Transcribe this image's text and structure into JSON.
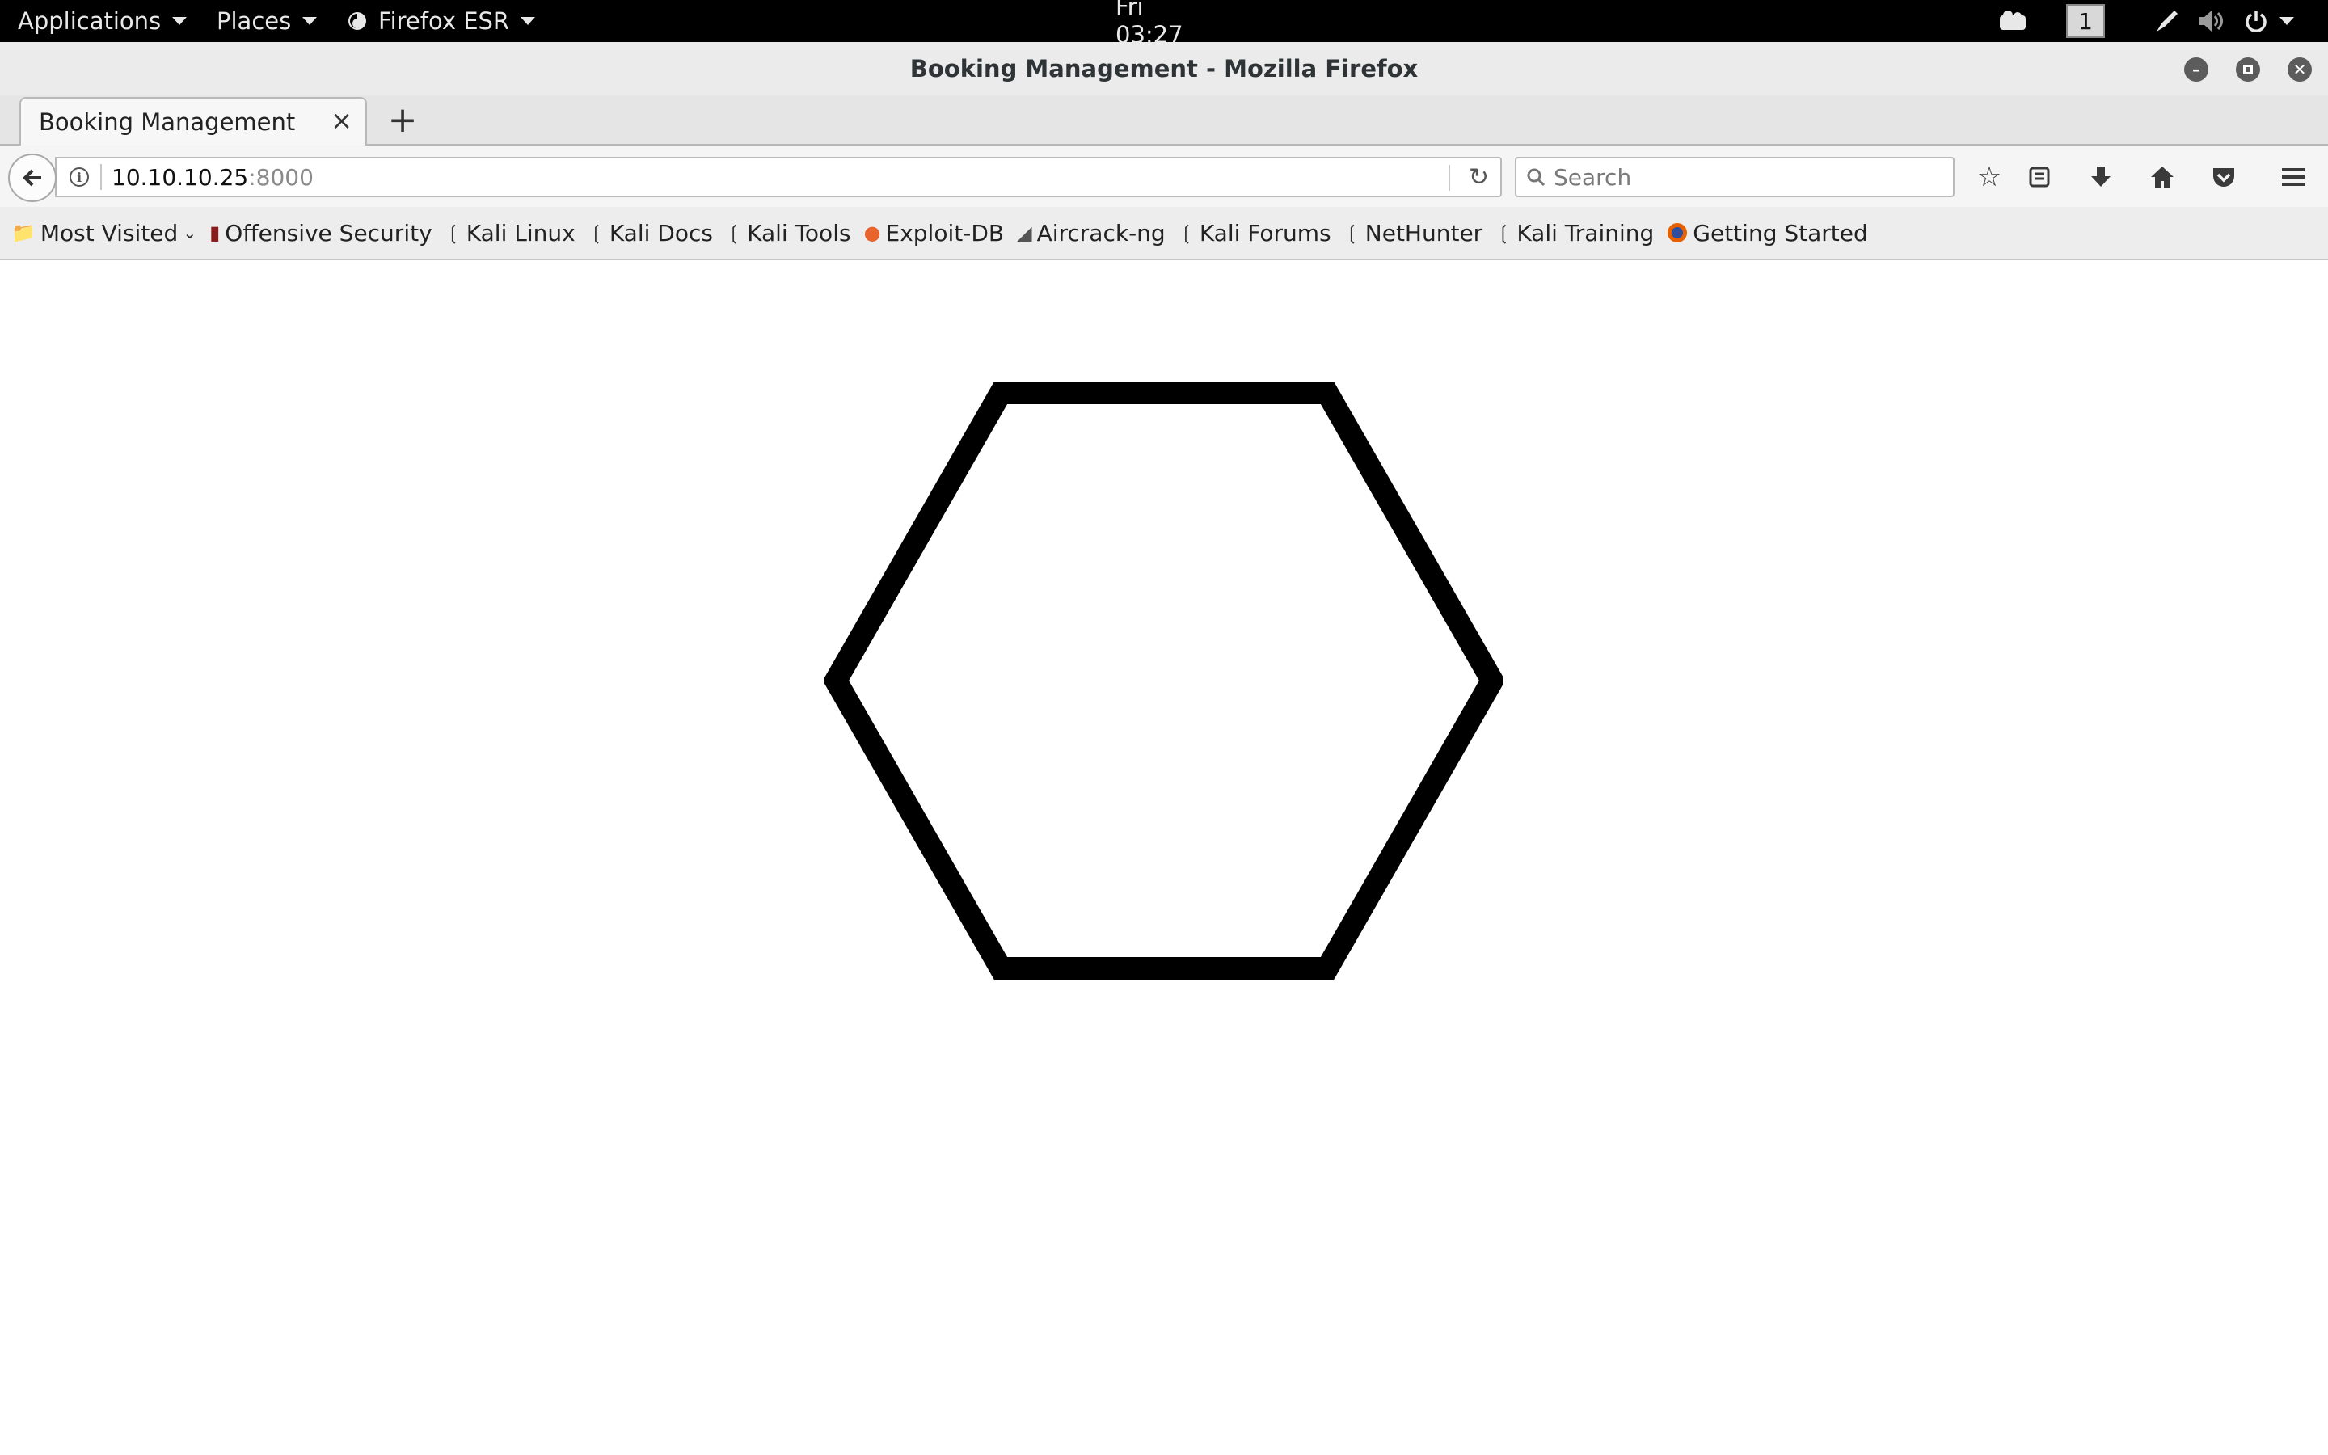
{
  "topbar": {
    "applications": "Applications",
    "places": "Places",
    "firefox": "Firefox ESR",
    "clock": "Fri 03:27",
    "workspace": "1"
  },
  "window": {
    "title": "Booking Management - Mozilla Firefox"
  },
  "tabs": [
    {
      "label": "Booking Management"
    }
  ],
  "navbar": {
    "url_host": "10.10.10.25",
    "url_port": ":8000",
    "search_placeholder": "Search"
  },
  "bookmarks": [
    {
      "label": "Most Visited",
      "icon": "folder-icon"
    },
    {
      "label": "Offensive Security",
      "icon": "offsec-icon"
    },
    {
      "label": "Kali Linux",
      "icon": "kali-dragon-icon"
    },
    {
      "label": "Kali Docs",
      "icon": "kali-dragon-icon"
    },
    {
      "label": "Kali Tools",
      "icon": "kali-dragon-icon"
    },
    {
      "label": "Exploit-DB",
      "icon": "exploitdb-icon"
    },
    {
      "label": "Aircrack-ng",
      "icon": "aircrack-icon"
    },
    {
      "label": "Kali Forums",
      "icon": "kali-dragon-icon"
    },
    {
      "label": "NetHunter",
      "icon": "kali-dragon-icon"
    },
    {
      "label": "Kali Training",
      "icon": "kali-dragon-icon"
    },
    {
      "label": "Getting Started",
      "icon": "firefox-icon"
    }
  ],
  "page": {
    "logo_icon": "hexagon-icon",
    "logo_color": "#000000"
  }
}
